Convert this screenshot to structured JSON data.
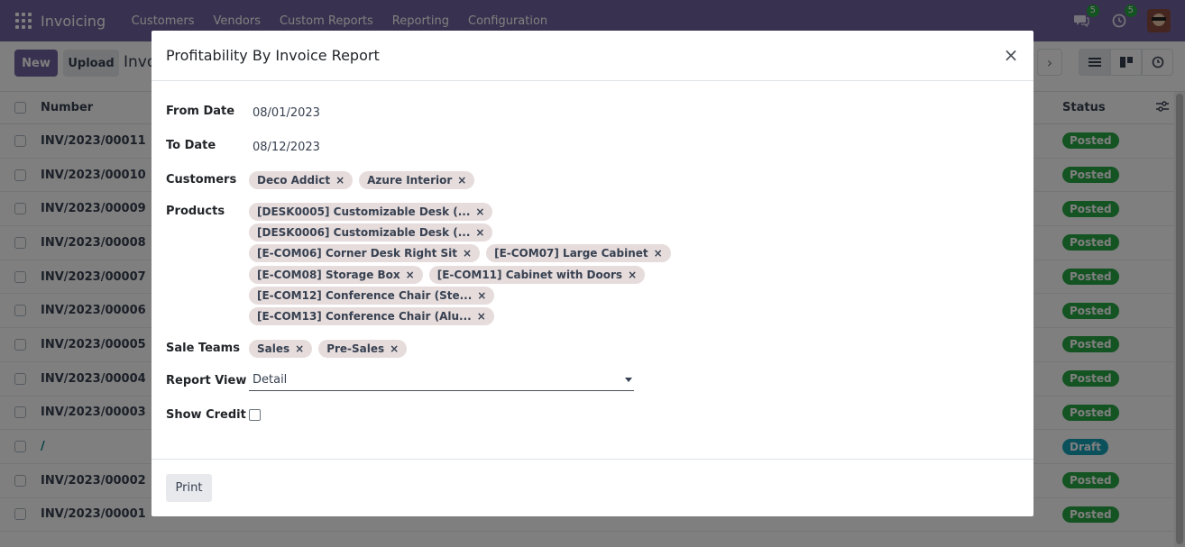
{
  "navbar": {
    "brand": "Invoicing",
    "menu": [
      "Customers",
      "Vendors",
      "Custom Reports",
      "Reporting",
      "Configuration"
    ],
    "messages_badge": "5",
    "activities_badge": "5",
    "icons": [
      "apps-icon",
      "chat-icon",
      "clock-icon",
      "avatar"
    ]
  },
  "control_panel": {
    "new_label": "New",
    "upload_label": "Upload",
    "title": "Invoic"
  },
  "list": {
    "headers": {
      "number": "Number",
      "status": "Status"
    },
    "rows": [
      {
        "number": "INV/2023/00011",
        "status": "Posted"
      },
      {
        "number": "INV/2023/00010",
        "status": "Posted"
      },
      {
        "number": "INV/2023/00009",
        "status": "Posted"
      },
      {
        "number": "INV/2023/00008",
        "status": "Posted"
      },
      {
        "number": "INV/2023/00007",
        "status": "Posted"
      },
      {
        "number": "INV/2023/00006",
        "status": "Posted"
      },
      {
        "number": "INV/2023/00005",
        "status": "Posted"
      },
      {
        "number": "INV/2023/00004",
        "status": "Posted"
      },
      {
        "number": "INV/2023/00003",
        "status": "Posted"
      },
      {
        "number": "/",
        "status": "Draft"
      },
      {
        "number": "INV/2023/00002",
        "status": "Posted"
      },
      {
        "number": "INV/2023/00001",
        "status": "Posted"
      }
    ]
  },
  "modal": {
    "title": "Profitability By Invoice Report",
    "from_date_label": "From Date",
    "from_date": "08/01/2023",
    "to_date_label": "To Date",
    "to_date": "08/12/2023",
    "customers_label": "Customers",
    "customers": [
      "Deco Addict",
      "Azure Interior"
    ],
    "products_label": "Products",
    "products": [
      [
        "[DESK0005] Customizable Desk (..."
      ],
      [
        "[DESK0006] Customizable Desk (..."
      ],
      [
        "[E-COM06] Corner Desk Right Sit",
        "[E-COM07] Large Cabinet"
      ],
      [
        "[E-COM08] Storage Box",
        "[E-COM11] Cabinet with Doors"
      ],
      [
        "[E-COM12] Conference Chair (Ste..."
      ],
      [
        "[E-COM13] Conference Chair (Alu..."
      ]
    ],
    "sale_teams_label": "Sale Teams",
    "sale_teams": [
      "Sales",
      "Pre-Sales"
    ],
    "report_view_label": "Report View",
    "report_view": "Detail",
    "show_credit_label": "Show Credit",
    "show_credit": false,
    "print_label": "Print",
    "tag_remove_glyph": "×",
    "close_glyph": "×"
  },
  "colors": {
    "navbar": "#71639e",
    "primary_button": "#71639e",
    "posted": "#28a745",
    "draft": "#17a2b8",
    "tag_bg": "#e6dcdc"
  }
}
